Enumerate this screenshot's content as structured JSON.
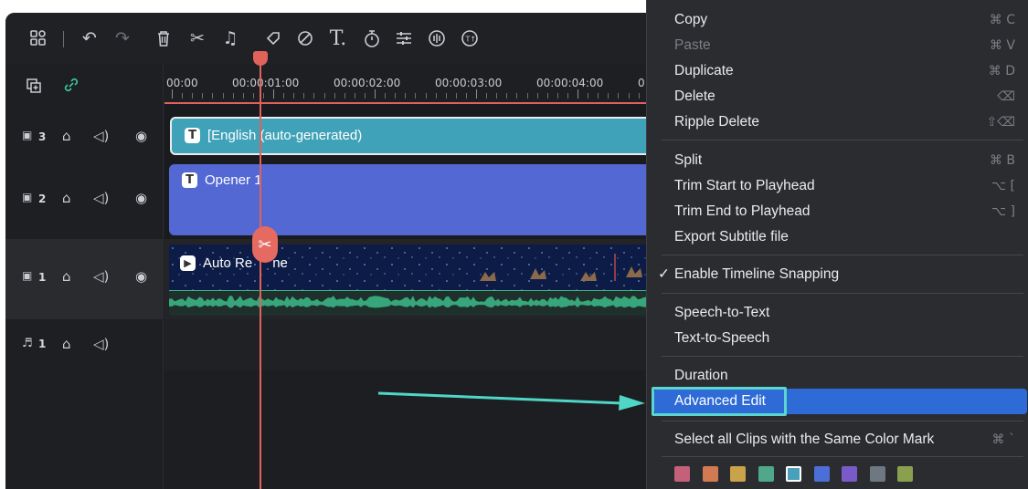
{
  "toolbar": {
    "icons": [
      "layout-icon",
      "undo-icon",
      "redo-icon",
      "delete-icon",
      "cut-icon",
      "audio-icon",
      "mark-icon",
      "color-icon",
      "text-icon",
      "speed-icon",
      "adjust-icon",
      "audio-stretch-icon",
      "tts-icon"
    ]
  },
  "ruler": {
    "labels": [
      "00:00",
      "00:00:01:00",
      "00:00:02:00",
      "00:00:03:00",
      "00:00:04:00",
      "0"
    ]
  },
  "tracks": [
    {
      "id": "3",
      "type": "video"
    },
    {
      "id": "2",
      "type": "video"
    },
    {
      "id": "1",
      "type": "video"
    },
    {
      "id": "1",
      "type": "audio"
    }
  ],
  "clips": {
    "subtitle": {
      "title": "[English (auto-generated)",
      "badge": "T"
    },
    "title": {
      "title": "Opener 1",
      "badge": "T"
    },
    "video": {
      "title": "Auto Re",
      "title_end": "ne",
      "badge": "▶"
    }
  },
  "menu": {
    "items": [
      {
        "label": "Copy",
        "shortcut": "⌘ C",
        "disabled": false
      },
      {
        "label": "Paste",
        "shortcut": "⌘ V",
        "disabled": true
      },
      {
        "label": "Duplicate",
        "shortcut": "⌘ D",
        "disabled": false
      },
      {
        "label": "Delete",
        "shortcut": "⌫",
        "disabled": false
      },
      {
        "label": "Ripple Delete",
        "shortcut": "⇧⌫",
        "disabled": false
      },
      {
        "label": "Split",
        "shortcut": "⌘ B",
        "disabled": false
      },
      {
        "label": "Trim Start to Playhead",
        "shortcut": "⌥ [",
        "disabled": false
      },
      {
        "label": "Trim End to Playhead",
        "shortcut": "⌥ ]",
        "disabled": false
      },
      {
        "label": "Export Subtitle file",
        "shortcut": "",
        "disabled": false
      },
      {
        "label": "Enable Timeline Snapping",
        "checked": true,
        "check": "✓"
      },
      {
        "label": "Speech-to-Text",
        "shortcut": ""
      },
      {
        "label": "Text-to-Speech",
        "shortcut": ""
      },
      {
        "label": "Duration",
        "shortcut": ""
      },
      {
        "label": "Advanced Edit",
        "shortcut": "",
        "highlighted": true
      },
      {
        "label": "Select all Clips with the Same Color Mark",
        "shortcut": "⌘ `"
      }
    ],
    "color_marks": [
      "#c4607a",
      "#d27a52",
      "#c9a24a",
      "#4fa889",
      "#4aa0b8",
      "#4b6fd6",
      "#7a5ac9",
      "#6d7880",
      "#8aa04e"
    ],
    "selected_color_index": 4
  },
  "colors": {
    "accent_playhead": "#e0625a",
    "subtitle_clip": "#3fa2b8",
    "title_clip": "#5468d4",
    "audio_wave": "#3dbb8a",
    "menu_highlight": "#2f6bd6",
    "annotation": "#4fd6c6"
  }
}
